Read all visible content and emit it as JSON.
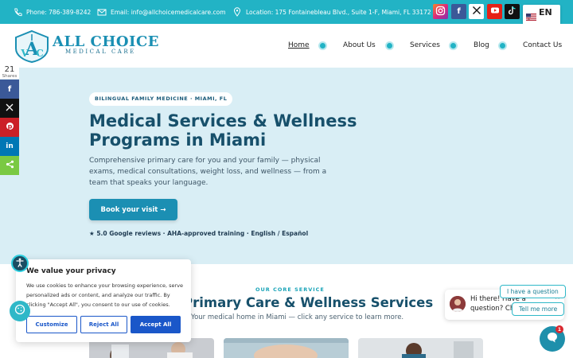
{
  "topbar": {
    "phone": "Phone: 786-389-8242",
    "email": "Email: info@allchoicemedicalcare.com",
    "location": "Location: 175 Fontainebleau Blvd., Suite 1-F, Miami, FL 33172",
    "social": [
      {
        "icon": "instagram-icon",
        "glyph": "◎",
        "color": "#c13584"
      },
      {
        "icon": "facebook-icon",
        "glyph": "f",
        "color": "#3b5998"
      },
      {
        "icon": "x-icon",
        "glyph": "𝕏",
        "color": "#ffffff"
      },
      {
        "icon": "youtube-icon",
        "glyph": "▶",
        "color": "#e62117"
      },
      {
        "icon": "tiktok-icon",
        "glyph": "♪",
        "color": "#111111"
      }
    ],
    "language": "EN"
  },
  "logo": {
    "title": "ALL CHOICE",
    "subtitle": "MEDICAL CARE"
  },
  "nav": {
    "items": [
      {
        "label": "Home",
        "active": true
      },
      {
        "label": "About Us",
        "active": false
      },
      {
        "label": "Services",
        "active": false
      },
      {
        "label": "Blog",
        "active": false
      },
      {
        "label": "Contact Us",
        "active": false
      }
    ]
  },
  "share": {
    "count": "21",
    "label": "Shares"
  },
  "hero": {
    "badge": "BILINGUAL FAMILY MEDICINE · MIAMI, FL",
    "title": "Medical Services & Wellness Programs in Miami",
    "lead": "Comprehensive primary care for you and your family — physical exams, medical consultations, weight loss, and wellness — from a team that speaks your language.",
    "cta": "Book your visit →",
    "trust": "★ 5.0 Google reviews   ·   AHA-approved training   ·   English / Español"
  },
  "services": {
    "eyebrow": "OUR CORE SERVICE",
    "title": "Primary Care & Wellness Services",
    "subtitle": "Your medical home in Miami — click any service to learn more."
  },
  "cookie": {
    "title": "We value your privacy",
    "body": "We use cookies to enhance your browsing experience, serve personalized ads or content, and analyze our traffic. By clicking \"Accept All\", you consent to our use of cookies.",
    "customize": "Customize",
    "reject": "Reject All",
    "accept": "Accept All"
  },
  "chat": {
    "message": "Hi there! Have a question? Ch",
    "chip1": "I have a question",
    "chip2": "Tell me more",
    "unread": "1"
  },
  "colors": {
    "topbar": "#22b3c5",
    "brand": "#1b8fb3",
    "heading": "#17506b",
    "hero_bg": "#d9eef5",
    "cookie_button": "#1a57c9"
  }
}
